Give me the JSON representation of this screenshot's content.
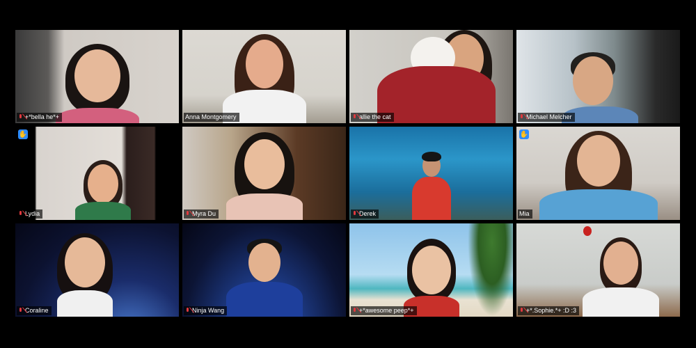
{
  "meeting": {
    "participants": [
      {
        "name": "+*bella he*+",
        "muted": true,
        "hand_raised": false,
        "active_speaker": false
      },
      {
        "name": "Anna Montgomery",
        "muted": false,
        "hand_raised": false,
        "active_speaker": true
      },
      {
        "name": "allie the cat",
        "muted": true,
        "hand_raised": false,
        "active_speaker": false
      },
      {
        "name": "Michael Melcher",
        "muted": true,
        "hand_raised": false,
        "active_speaker": false
      },
      {
        "name": "Lydia",
        "muted": true,
        "hand_raised": true,
        "active_speaker": false
      },
      {
        "name": "Myra Du",
        "muted": true,
        "hand_raised": false,
        "active_speaker": false
      },
      {
        "name": "Derek",
        "muted": true,
        "hand_raised": false,
        "active_speaker": false
      },
      {
        "name": "Mia",
        "muted": false,
        "hand_raised": true,
        "active_speaker": false
      },
      {
        "name": "Coraline",
        "muted": true,
        "hand_raised": false,
        "active_speaker": false
      },
      {
        "name": "Ninja Wang",
        "muted": true,
        "hand_raised": false,
        "active_speaker": false
      },
      {
        "name": "+*awesome peep*+",
        "muted": true,
        "hand_raised": false,
        "active_speaker": false
      },
      {
        "name": "+*.Sophie.*+ :D :3",
        "muted": true,
        "hand_raised": false,
        "active_speaker": false
      }
    ]
  },
  "colors": {
    "active_speaker_border": "#c8e05a",
    "muted_icon": "#e0393e",
    "raise_hand_badge": "#2d8cff"
  },
  "icons": {
    "muted": "mic-muted-icon",
    "hand": "raise-hand-icon"
  }
}
